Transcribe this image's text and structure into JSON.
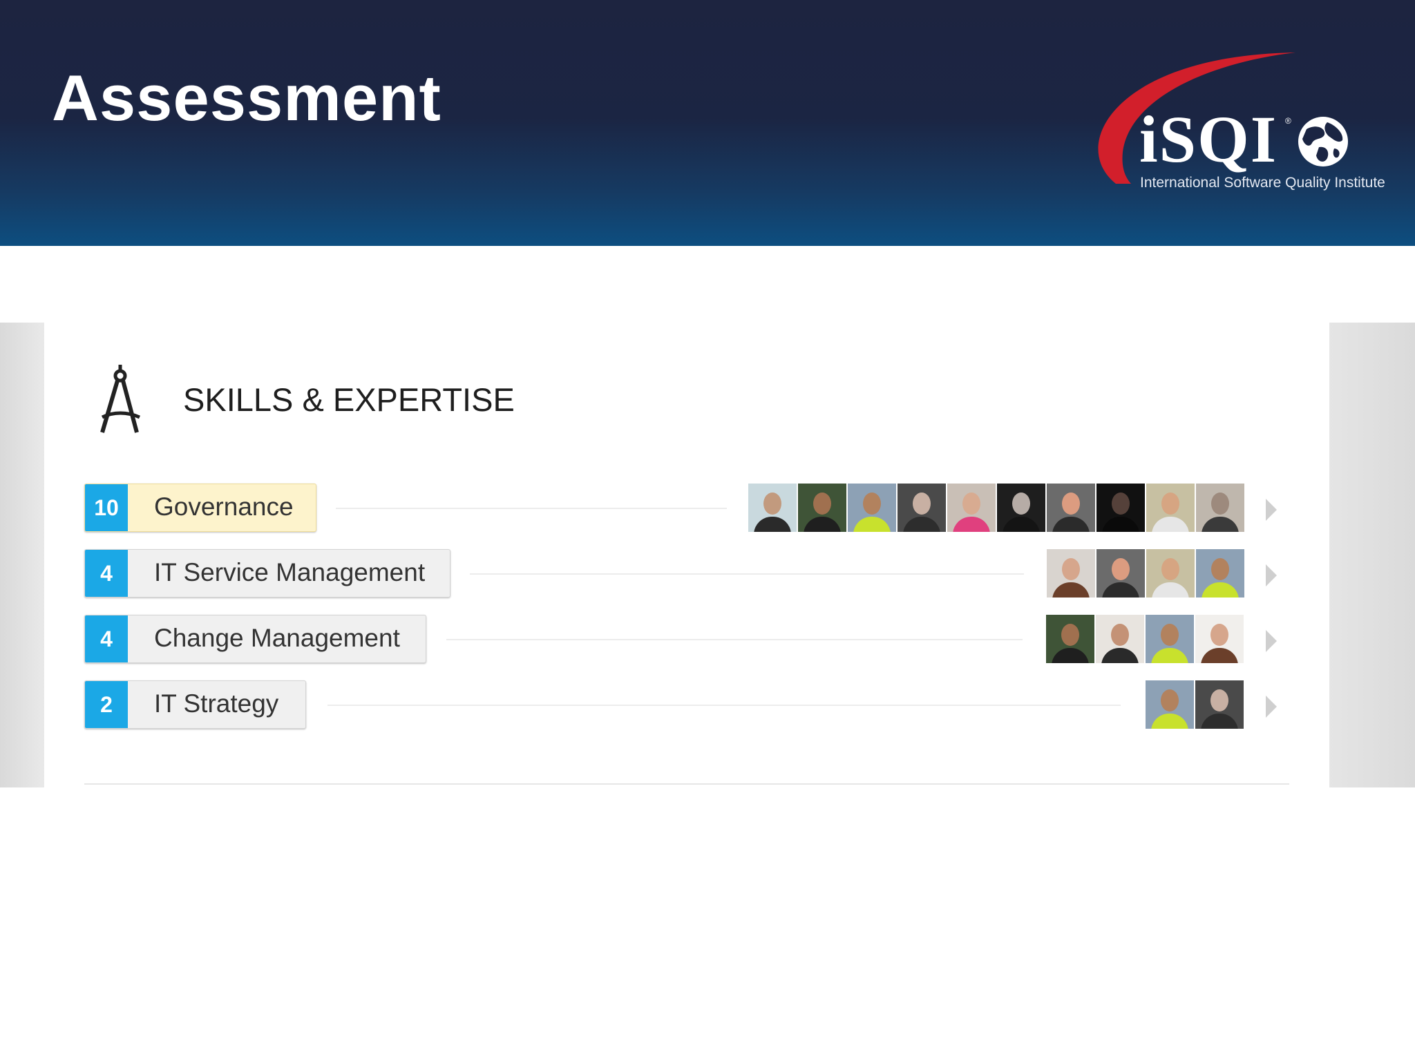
{
  "slide": {
    "title": "Assessment"
  },
  "logo": {
    "wordmark": "iSQI",
    "registered_mark": "®",
    "tagline": "International Software Quality Institute",
    "colors": {
      "swoosh": "#d21f2b",
      "text": "#ffffff"
    }
  },
  "section": {
    "title": "SKILLS & EXPERTISE",
    "icon": "drafting-compass-icon"
  },
  "skills": [
    {
      "count": "10",
      "name": "Governance",
      "highlighted": true,
      "endorser_count": 10
    },
    {
      "count": "4",
      "name": "IT Service Management",
      "highlighted": false,
      "endorser_count": 4
    },
    {
      "count": "4",
      "name": "Change Management",
      "highlighted": false,
      "endorser_count": 4
    },
    {
      "count": "2",
      "name": "IT Strategy",
      "highlighted": false,
      "endorser_count": 2
    }
  ],
  "colors": {
    "banner": "#1b2543",
    "count_badge": "#1ba8e6",
    "highlight": "#fdf3cc"
  }
}
